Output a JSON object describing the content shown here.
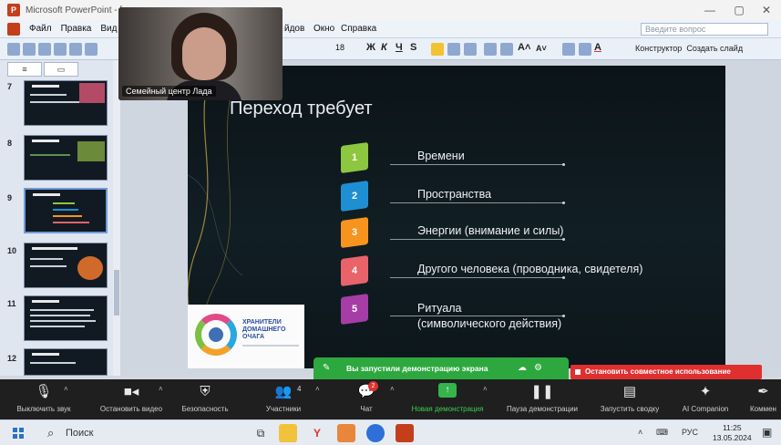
{
  "window": {
    "title": "Microsoft PowerPoint - ["
  },
  "menu": {
    "items": [
      "Файл",
      "Правка",
      "Вид"
    ],
    "items_right": [
      "йдов",
      "Окно",
      "Справка"
    ],
    "help_placeholder": "Введите вопрос"
  },
  "toolbar": {
    "font_size": "18",
    "designer_label": "Конструктор",
    "create_slide_label": "Создать слайд"
  },
  "left_panel": {
    "thumbnails": [
      {
        "num": "7"
      },
      {
        "num": "8"
      },
      {
        "num": "9"
      },
      {
        "num": "10"
      },
      {
        "num": "11"
      },
      {
        "num": "12"
      }
    ]
  },
  "video": {
    "participant_name": "Семейный центр Лада"
  },
  "slide": {
    "title": "Переход требует",
    "items": [
      {
        "num": "1",
        "text": "Времени",
        "color": "#8dc63f"
      },
      {
        "num": "2",
        "text": "Пространства",
        "color": "#1f8fd4"
      },
      {
        "num": "3",
        "text": "Энергии (внимание и силы)",
        "color": "#f7941d"
      },
      {
        "num": "4",
        "text": "Другого человека (проводника, свидетеля)",
        "color": "#e8636a"
      },
      {
        "num": "5",
        "text": "Ритуала\n(символического действия)",
        "color": "#a63da6"
      }
    ],
    "logo": {
      "line1": "ХРАНИТЕЛИ",
      "line2": "ДОМАШНЕГО",
      "line3": "ОЧАГА"
    }
  },
  "share": {
    "notice": "Вы запустили демонстрацию экрана",
    "stop_label": "Остановить совместное использование"
  },
  "zoom_toolbar": {
    "mute": "Выключить звук",
    "video": "Остановить видео",
    "security": "Безопасность",
    "participants": "Участники",
    "participants_count": "4",
    "chat": "Чат",
    "chat_badge": "2",
    "new_share": "Новая демонстрация",
    "pause_share": "Пауза демонстрации",
    "summary": "Запустить сводку",
    "companion": "AI Companion",
    "comments": "Коммен"
  },
  "taskbar": {
    "search": "Поиск",
    "lang": "РУС",
    "time": "11:25",
    "date": "13.05.2024"
  }
}
